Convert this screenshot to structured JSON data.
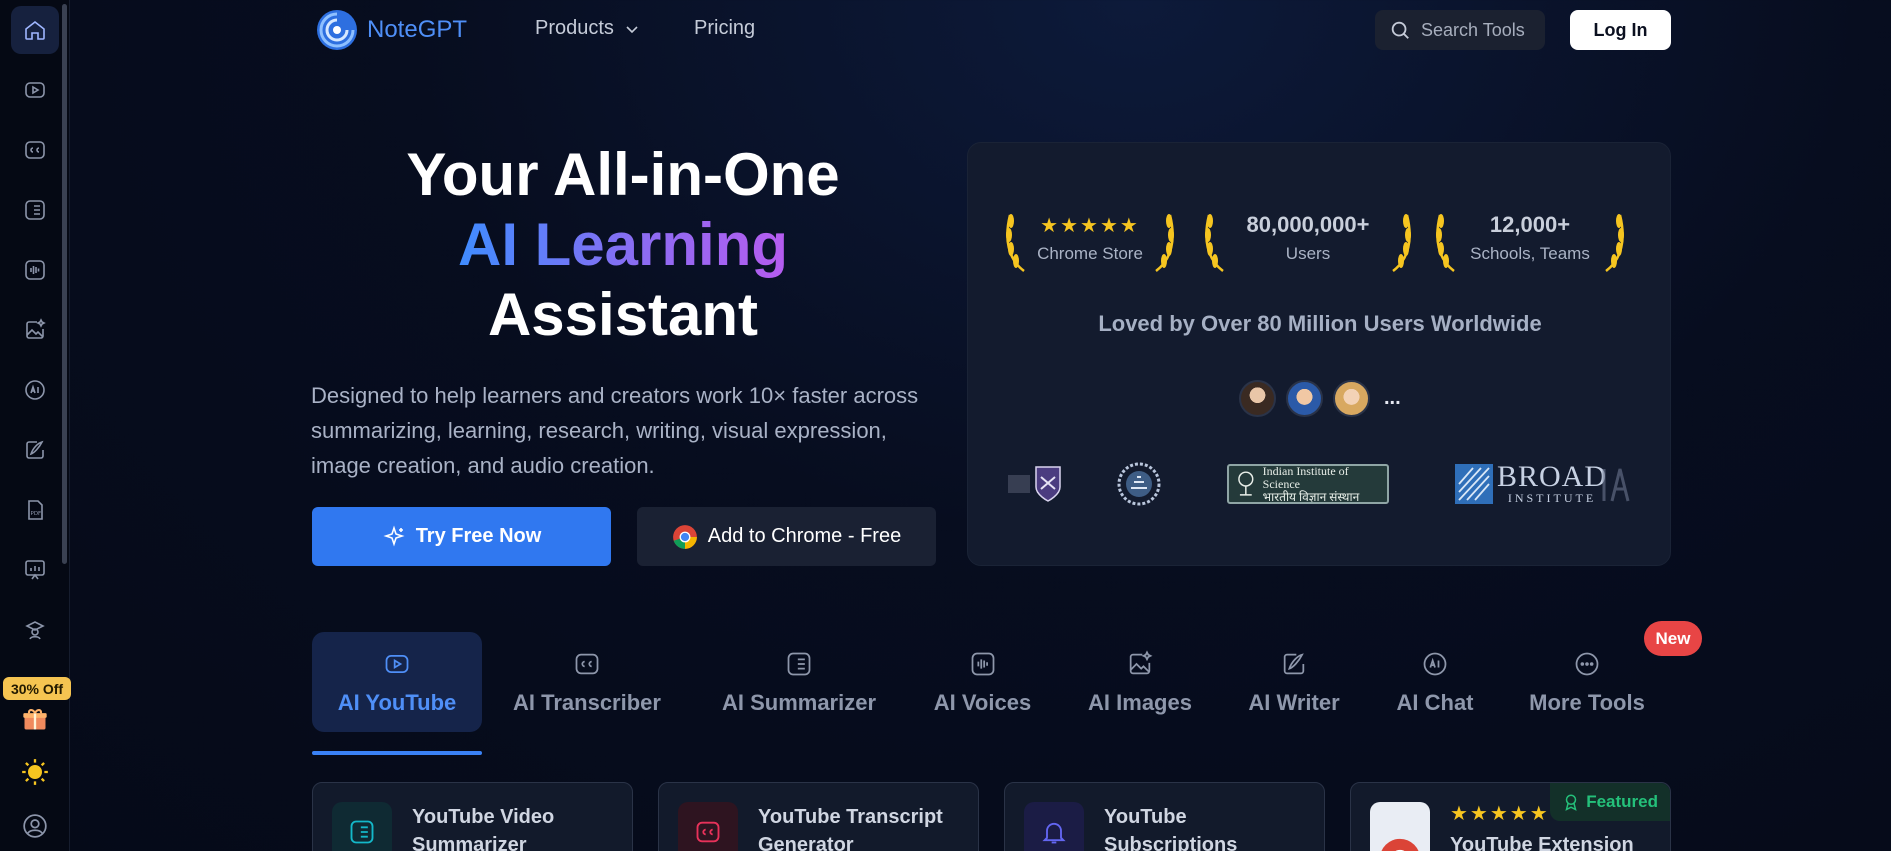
{
  "brand": {
    "name": "NoteGPT",
    "logo_icon": "swirl-logo-icon",
    "accent": "#3078f0"
  },
  "nav": {
    "products_label": "Products",
    "pricing_label": "Pricing",
    "search_placeholder": "Search Tools",
    "login_label": "Log In"
  },
  "sidebar": {
    "items": [
      {
        "icon": "home-icon"
      },
      {
        "icon": "youtube-icon"
      },
      {
        "icon": "cc-icon"
      },
      {
        "icon": "list-icon"
      },
      {
        "icon": "audio-wave-icon"
      },
      {
        "icon": "image-sparkle-icon"
      },
      {
        "icon": "ai-chat-icon"
      },
      {
        "icon": "pen-icon"
      },
      {
        "icon": "pdf-icon"
      },
      {
        "icon": "presentation-icon"
      },
      {
        "icon": "graduate-icon"
      }
    ],
    "offer_badge": "30% Off",
    "gift_icon": "gift-icon",
    "theme_icon": "sun-icon",
    "profile_icon": "user-circle-icon"
  },
  "hero": {
    "title_line1": "Your All-in-One",
    "title_line2": "AI Learning",
    "title_line3": "Assistant",
    "description": "Designed to help learners and creators work 10× faster across summarizing, learning, research, writing, visual expression, image creation, and audio creation.",
    "try_button": "Try Free Now",
    "chrome_button": "Add to Chrome - Free"
  },
  "stats": {
    "chrome_store_rating": 5,
    "chrome_store_label": "Chrome Store",
    "users_value": "80,000,000+",
    "users_label": "Users",
    "schools_value": "12,000+",
    "schools_label": "Schools, Teams",
    "loved_text": "Loved by Over 80 Million Users Worldwide",
    "more_users": "...",
    "logos": {
      "iisc_line1": "Indian Institute of Science",
      "iisc_line2": "भारतीय विज्ञान संस्थान",
      "broad_line1": "BROAD",
      "broad_line2": "INSTITUTE"
    }
  },
  "tabs": [
    {
      "label": "AI YouTube",
      "icon": "youtube-icon",
      "active": true
    },
    {
      "label": "AI Transcriber",
      "icon": "cc-icon"
    },
    {
      "label": "AI Summarizer",
      "icon": "list-icon"
    },
    {
      "label": "AI Voices",
      "icon": "audio-wave-icon"
    },
    {
      "label": "AI Images",
      "icon": "image-sparkle-icon"
    },
    {
      "label": "AI Writer",
      "icon": "pen-icon"
    },
    {
      "label": "AI Chat",
      "icon": "ai-chat-icon"
    },
    {
      "label": "More Tools",
      "icon": "more-dots-icon"
    }
  ],
  "new_badge": "New",
  "cards": [
    {
      "title": "YouTube Video Summarizer",
      "icon": "list-icon",
      "color": "#14b8c9"
    },
    {
      "title": "YouTube Transcript Generator",
      "icon": "cc-icon",
      "color": "#e8325a"
    },
    {
      "title": "YouTube Subscriptions",
      "icon": "bell-icon",
      "color": "#6366f1"
    },
    {
      "title": "YouTube Extension",
      "icon": "chrome-icon",
      "rating": 5,
      "featured_label": "Featured"
    }
  ]
}
